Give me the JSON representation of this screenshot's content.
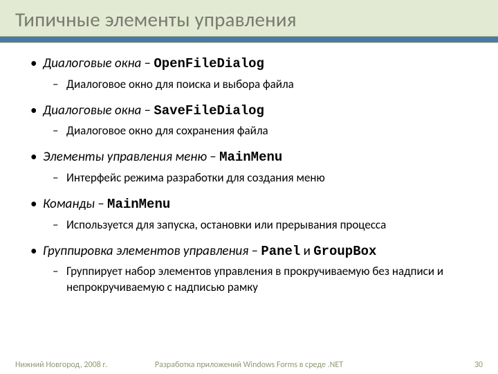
{
  "title": "Типичные элементы управления",
  "items": [
    {
      "term": "Диалоговые окна",
      "code": "OpenFileDialog",
      "desc": "Диалоговое окно для поиска и выбора файла"
    },
    {
      "term": "Диалоговые окна",
      "code": "SaveFileDialog",
      "desc": "Диалоговое  окно для сохранения файла"
    },
    {
      "term": "Элементы управления меню",
      "code": "MainMenu",
      "desc": "Интерфейс режима разработки для создания меню"
    },
    {
      "term": "Команды",
      "code": "MainMenu",
      "desc": "Используется для запуска, остановки или прерывания процесса"
    },
    {
      "term": "Группировка элементов управления",
      "code": "Panel",
      "and": " и ",
      "code2": "GroupBox",
      "desc": "Группирует набор элементов управления в прокручиваемую без надписи и непрокручиваемую с надписью рамку"
    }
  ],
  "footer": {
    "left": "Нижний Новгород, 2008 г.",
    "center": "Разработка приложений Windows Forms в среде .NET",
    "page": "30"
  }
}
